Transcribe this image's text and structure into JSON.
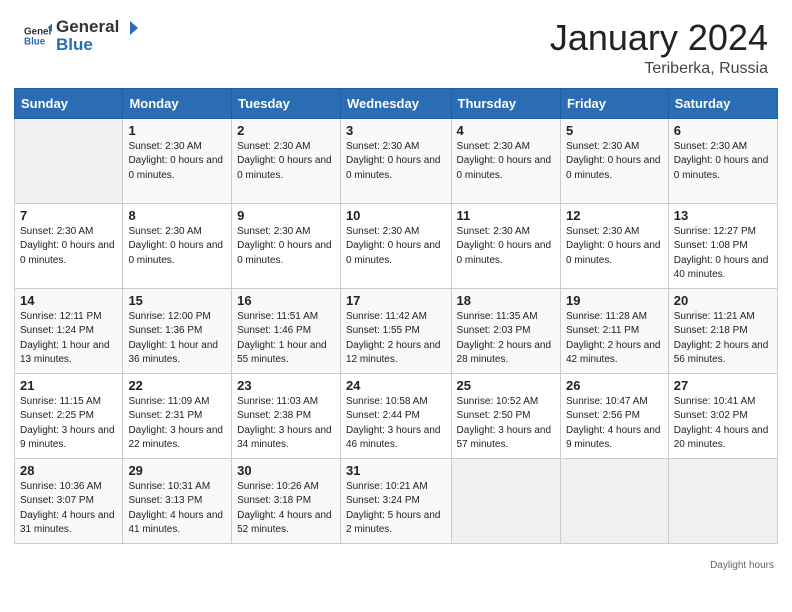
{
  "header": {
    "logo_general": "General",
    "logo_blue": "Blue",
    "month": "January 2024",
    "location": "Teriberka, Russia"
  },
  "weekdays": [
    "Sunday",
    "Monday",
    "Tuesday",
    "Wednesday",
    "Thursday",
    "Friday",
    "Saturday"
  ],
  "weeks": [
    [
      {
        "num": "",
        "info": ""
      },
      {
        "num": "1",
        "info": "Sunset: 2:30 AM\nDaylight: 0 hours\nand 0 minutes."
      },
      {
        "num": "2",
        "info": "Sunset: 2:30 AM\nDaylight: 0 hours\nand 0 minutes."
      },
      {
        "num": "3",
        "info": "Sunset: 2:30 AM\nDaylight: 0 hours\nand 0 minutes."
      },
      {
        "num": "4",
        "info": "Sunset: 2:30 AM\nDaylight: 0 hours\nand 0 minutes."
      },
      {
        "num": "5",
        "info": "Sunset: 2:30 AM\nDaylight: 0 hours\nand 0 minutes."
      },
      {
        "num": "6",
        "info": "Sunset: 2:30 AM\nDaylight: 0 hours\nand 0 minutes."
      }
    ],
    [
      {
        "num": "7",
        "info": "Sunset: 2:30 AM\nDaylight: 0 hours\nand 0 minutes."
      },
      {
        "num": "8",
        "info": "Sunset: 2:30 AM\nDaylight: 0 hours\nand 0 minutes."
      },
      {
        "num": "9",
        "info": "Sunset: 2:30 AM\nDaylight: 0 hours\nand 0 minutes."
      },
      {
        "num": "10",
        "info": "Sunset: 2:30 AM\nDaylight: 0 hours\nand 0 minutes."
      },
      {
        "num": "11",
        "info": "Sunset: 2:30 AM\nDaylight: 0 hours\nand 0 minutes."
      },
      {
        "num": "12",
        "info": "Sunset: 2:30 AM\nDaylight: 0 hours\nand 0 minutes."
      },
      {
        "num": "13",
        "info": "Sunrise: 12:27 PM\nSunset: 1:08 PM\nDaylight: 0 hours\nand 40 minutes."
      }
    ],
    [
      {
        "num": "14",
        "info": "Sunrise: 12:11 PM\nSunset: 1:24 PM\nDaylight: 1 hour and\n13 minutes."
      },
      {
        "num": "15",
        "info": "Sunrise: 12:00 PM\nSunset: 1:36 PM\nDaylight: 1 hour and\n36 minutes."
      },
      {
        "num": "16",
        "info": "Sunrise: 11:51 AM\nSunset: 1:46 PM\nDaylight: 1 hour and\n55 minutes."
      },
      {
        "num": "17",
        "info": "Sunrise: 11:42 AM\nSunset: 1:55 PM\nDaylight: 2 hours\nand 12 minutes."
      },
      {
        "num": "18",
        "info": "Sunrise: 11:35 AM\nSunset: 2:03 PM\nDaylight: 2 hours\nand 28 minutes."
      },
      {
        "num": "19",
        "info": "Sunrise: 11:28 AM\nSunset: 2:11 PM\nDaylight: 2 hours\nand 42 minutes."
      },
      {
        "num": "20",
        "info": "Sunrise: 11:21 AM\nSunset: 2:18 PM\nDaylight: 2 hours\nand 56 minutes."
      }
    ],
    [
      {
        "num": "21",
        "info": "Sunrise: 11:15 AM\nSunset: 2:25 PM\nDaylight: 3 hours\nand 9 minutes."
      },
      {
        "num": "22",
        "info": "Sunrise: 11:09 AM\nSunset: 2:31 PM\nDaylight: 3 hours\nand 22 minutes."
      },
      {
        "num": "23",
        "info": "Sunrise: 11:03 AM\nSunset: 2:38 PM\nDaylight: 3 hours\nand 34 minutes."
      },
      {
        "num": "24",
        "info": "Sunrise: 10:58 AM\nSunset: 2:44 PM\nDaylight: 3 hours\nand 46 minutes."
      },
      {
        "num": "25",
        "info": "Sunrise: 10:52 AM\nSunset: 2:50 PM\nDaylight: 3 hours\nand 57 minutes."
      },
      {
        "num": "26",
        "info": "Sunrise: 10:47 AM\nSunset: 2:56 PM\nDaylight: 4 hours\nand 9 minutes."
      },
      {
        "num": "27",
        "info": "Sunrise: 10:41 AM\nSunset: 3:02 PM\nDaylight: 4 hours\nand 20 minutes."
      }
    ],
    [
      {
        "num": "28",
        "info": "Sunrise: 10:36 AM\nSunset: 3:07 PM\nDaylight: 4 hours\nand 31 minutes."
      },
      {
        "num": "29",
        "info": "Sunrise: 10:31 AM\nSunset: 3:13 PM\nDaylight: 4 hours\nand 41 minutes."
      },
      {
        "num": "30",
        "info": "Sunrise: 10:26 AM\nSunset: 3:18 PM\nDaylight: 4 hours\nand 52 minutes."
      },
      {
        "num": "31",
        "info": "Sunrise: 10:21 AM\nSunset: 3:24 PM\nDaylight: 5 hours\nand 2 minutes."
      },
      {
        "num": "",
        "info": ""
      },
      {
        "num": "",
        "info": ""
      },
      {
        "num": "",
        "info": ""
      }
    ]
  ],
  "footer": "Daylight hours"
}
